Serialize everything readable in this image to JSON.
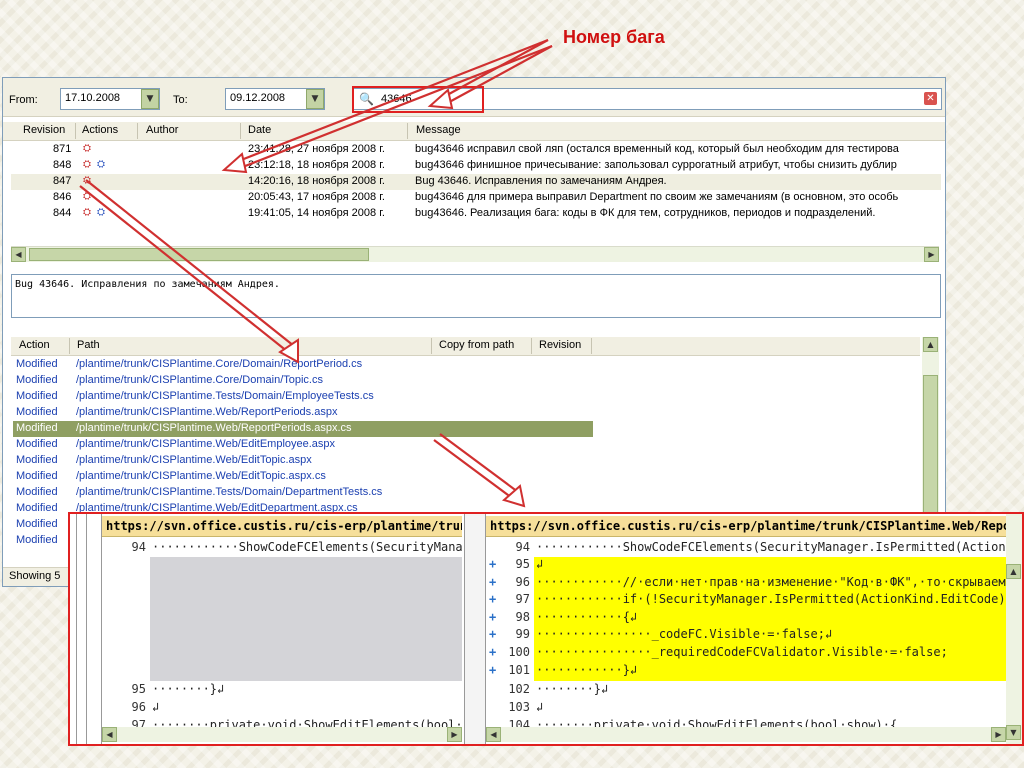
{
  "annotation": {
    "label": "Номер бага"
  },
  "filter": {
    "from_label": "From:",
    "from_value": "17.10.2008",
    "to_label": "To:",
    "to_value": "09.12.2008",
    "search_value": "43646"
  },
  "log": {
    "columns": [
      "Revision",
      "Actions",
      "Author",
      "Date",
      "Message"
    ],
    "rows": [
      {
        "revision": "871",
        "date": "23:41:28, 27 ноября 2008 г.",
        "message": "bug43646 исправил свой ляп (остался временный код, который был необходим для тестирова"
      },
      {
        "revision": "848",
        "date": "23:12:18, 18 ноября 2008 г.",
        "message": "bug43646 финишное причесывание: запользовал суррогатный атрибут, чтобы снизить дублир"
      },
      {
        "revision": "847",
        "date": "14:20:16, 18 ноября 2008 г.",
        "message": "Bug 43646. Исправления по замечаниям Андрея."
      },
      {
        "revision": "846",
        "date": "20:05:43, 17 ноября 2008 г.",
        "message": "bug43646 для примера выправил Department по своим же замечаниям (в основном, это особь"
      },
      {
        "revision": "844",
        "date": "19:41:05, 14 ноября 2008 г.",
        "message": "bug43646. Реализация бага: коды в ФК для тем, сотрудников, периодов и подразделений."
      }
    ]
  },
  "message_text": "Bug 43646. Исправления по замечаниям Андрея.",
  "paths": {
    "columns": [
      "Action",
      "Path",
      "Copy from path",
      "Revision"
    ],
    "rows": [
      {
        "action": "Modified",
        "path": "/plantime/trunk/CISPlantime.Core/Domain/ReportPeriod.cs"
      },
      {
        "action": "Modified",
        "path": "/plantime/trunk/CISPlantime.Core/Domain/Topic.cs"
      },
      {
        "action": "Modified",
        "path": "/plantime/trunk/CISPlantime.Tests/Domain/EmployeeTests.cs"
      },
      {
        "action": "Modified",
        "path": "/plantime/trunk/CISPlantime.Web/ReportPeriods.aspx"
      },
      {
        "action": "Modified",
        "path": "/plantime/trunk/CISPlantime.Web/ReportPeriods.aspx.cs"
      },
      {
        "action": "Modified",
        "path": "/plantime/trunk/CISPlantime.Web/EditEmployee.aspx"
      },
      {
        "action": "Modified",
        "path": "/plantime/trunk/CISPlantime.Web/EditTopic.aspx"
      },
      {
        "action": "Modified",
        "path": "/plantime/trunk/CISPlantime.Web/EditTopic.aspx.cs"
      },
      {
        "action": "Modified",
        "path": "/plantime/trunk/CISPlantime.Tests/Domain/DepartmentTests.cs"
      },
      {
        "action": "Modified",
        "path": "/plantime/trunk/CISPlantime.Web/EditDepartment.aspx.cs"
      },
      {
        "action": "Modified",
        "path": ""
      },
      {
        "action": "Modified",
        "path": ""
      }
    ]
  },
  "status_text": "Showing 5",
  "diff": {
    "left_url": "https://svn.office.custis.ru/cis-erp/plantime/trunk/CISPlantime.Web/ReportPeriods.aspx.cs",
    "right_url": "https://svn.office.custis.ru/cis-erp/plantime/trunk/CISPlantime.Web/ReportPeriods.aspx.cs",
    "left_lines": [
      {
        "n": "94",
        "text": "············ShowCodeFCElements(SecurityManager.IsPermitted(ActionKind.EditCode));"
      },
      {
        "n": "95",
        "text": "········}↲"
      },
      {
        "n": "96",
        "text": "↲"
      },
      {
        "n": "97",
        "text": "········private·void·ShowEditElements(bool·show)·{"
      }
    ],
    "right_lines": [
      {
        "n": "94",
        "mark": "",
        "text": "············ShowCodeFCElements(SecurityManager.IsPermitted(ActionKind.EditCode));"
      },
      {
        "n": "95",
        "mark": "+",
        "text": "↲"
      },
      {
        "n": "96",
        "mark": "+",
        "text": "············//·если·нет·прав·на·изменение·\"Код·в·ФК\",·то·скрываем"
      },
      {
        "n": "97",
        "mark": "+",
        "text": "············if·(!SecurityManager.IsPermitted(ActionKind.EditCode))"
      },
      {
        "n": "98",
        "mark": "+",
        "text": "············{↲"
      },
      {
        "n": "99",
        "mark": "+",
        "text": "················_codeFC.Visible·=·false;↲"
      },
      {
        "n": "100",
        "mark": "+",
        "text": "················_requiredCodeFCValidator.Visible·=·false;"
      },
      {
        "n": "101",
        "mark": "+",
        "text": "············}↲"
      },
      {
        "n": "102",
        "mark": "",
        "text": "········}↲"
      },
      {
        "n": "103",
        "mark": "",
        "text": "↲"
      },
      {
        "n": "104",
        "mark": "",
        "text": "········private·void·ShowEditElements(bool·show)·{"
      }
    ]
  },
  "colors": {
    "accent_red": "#e02020",
    "added_line": "#ffff00",
    "selected_row": "#8f9f62",
    "link_blue": "#1a3fb0"
  }
}
